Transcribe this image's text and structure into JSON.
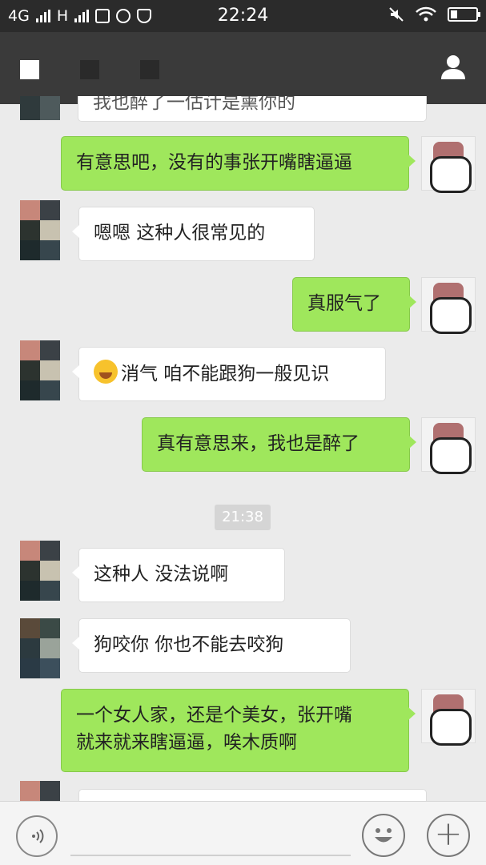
{
  "status_bar": {
    "network": "4G",
    "carrier_h": "H",
    "time": "22:24"
  },
  "chat": {
    "timestamp": "21:38",
    "messages": [
      {
        "side": "in",
        "text": "我也醉了一估计是熏你的"
      },
      {
        "side": "out",
        "text": "有意思吧，没有的事张开嘴瞎逼逼"
      },
      {
        "side": "in",
        "text": "嗯嗯  这种人很常见的"
      },
      {
        "side": "out",
        "text": "真服气了"
      },
      {
        "side": "in",
        "text": "消气  咱不能跟狗一般见识",
        "emoji": "laughing-tears-emoji"
      },
      {
        "side": "out",
        "text": "真有意思来，我也是醉了"
      },
      {
        "side": "in",
        "text": "这种人 没法说啊"
      },
      {
        "side": "in",
        "text": "狗咬你  你也不能去咬狗"
      },
      {
        "side": "out",
        "line1": "一个女人家，还是个美女，张开嘴",
        "line2": "就来就来瞎逼逼，唉木质啊"
      }
    ]
  },
  "icons": {
    "voice": "voice-icon",
    "emoji": "emoji-icon",
    "plus": "plus-icon",
    "contact": "person-icon"
  },
  "colors": {
    "outgoing_bubble": "#9fe75c",
    "incoming_bubble": "#ffffff",
    "nav_bar": "#3a3a3a",
    "status_bar": "#2b2b2b",
    "chat_background": "#ebebeb"
  }
}
